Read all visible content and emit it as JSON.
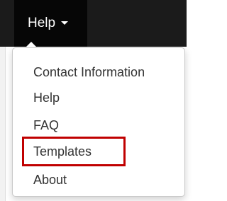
{
  "navbar": {
    "menu_label": "Help",
    "background_color": "#1b1b1b",
    "active_color": "#060606",
    "caret_icon": "caret-down-icon"
  },
  "dropdown": {
    "items": [
      {
        "label": "Contact Information"
      },
      {
        "label": "Help"
      },
      {
        "label": "FAQ"
      },
      {
        "label": "Templates",
        "highlighted": true
      },
      {
        "label": "About"
      }
    ],
    "highlight_color": "#c00000"
  }
}
